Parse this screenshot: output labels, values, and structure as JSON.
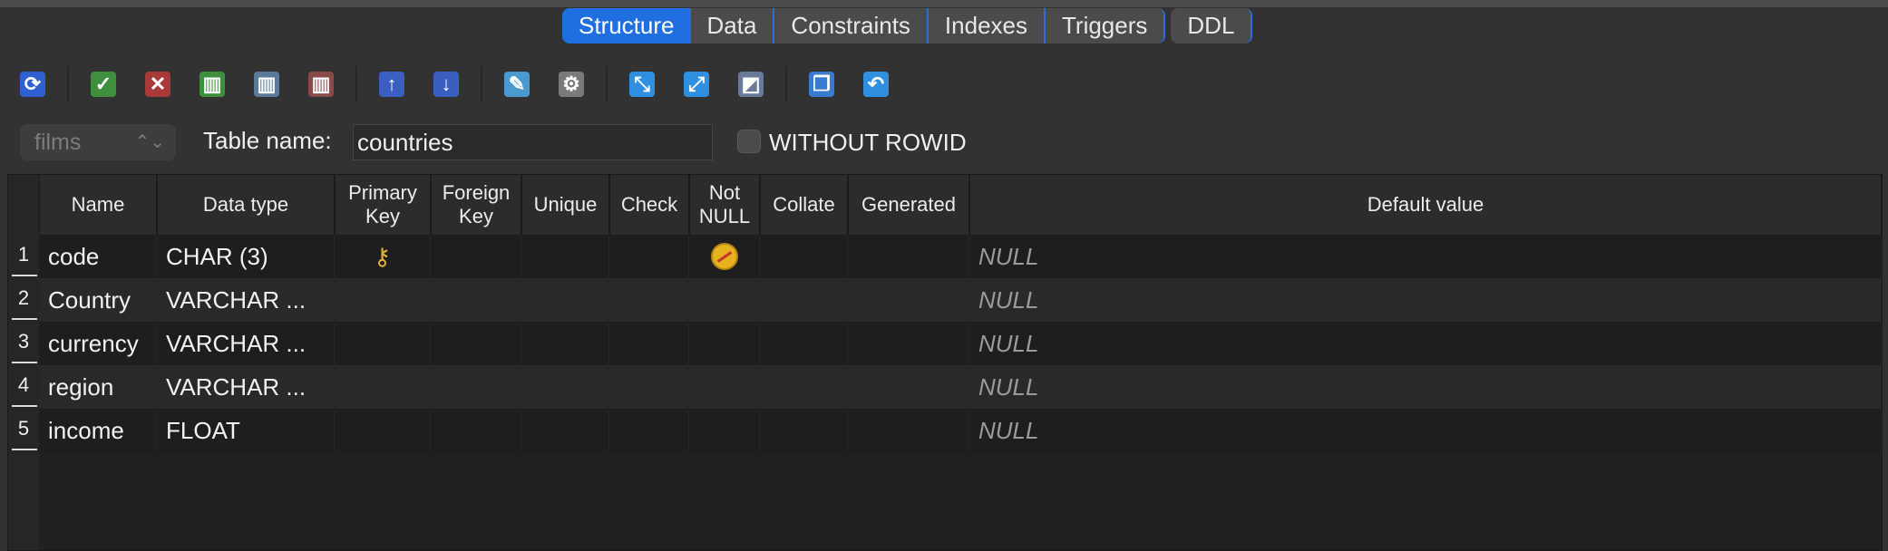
{
  "tabs": [
    "Structure",
    "Data",
    "Constraints",
    "Indexes",
    "Triggers",
    "DDL"
  ],
  "toolbar": {
    "icons": [
      {
        "name": "refresh-icon",
        "color": "#2f5fd0",
        "glyph": "⟳"
      },
      {
        "name": "commit-check-icon",
        "color": "#3f8f3f",
        "glyph": "✓"
      },
      {
        "name": "cancel-x-icon",
        "color": "#a83a3a",
        "glyph": "✕"
      },
      {
        "name": "add-column-icon",
        "color": "#3f8f3f",
        "glyph": "▥"
      },
      {
        "name": "edit-column-icon",
        "color": "#5a7a9a",
        "glyph": "▥"
      },
      {
        "name": "delete-column-icon",
        "color": "#8a4a4a",
        "glyph": "▥"
      },
      {
        "name": "move-up-icon",
        "color": "#3a5fc0",
        "glyph": "↑"
      },
      {
        "name": "move-down-icon",
        "color": "#3a5fc0",
        "glyph": "↓"
      },
      {
        "name": "add-constraint-icon",
        "color": "#4a9ad0",
        "glyph": "✎"
      },
      {
        "name": "settings-gear-icon",
        "color": "#7a7a7a",
        "glyph": "⚙"
      },
      {
        "name": "collapse-icon",
        "color": "#2f8fe0",
        "glyph": "⤡"
      },
      {
        "name": "expand-icon",
        "color": "#2f8fe0",
        "glyph": "⤢"
      },
      {
        "name": "image-export-icon",
        "color": "#6a7a9a",
        "glyph": "◩"
      },
      {
        "name": "windows-icon",
        "color": "#3a7ad0",
        "glyph": "❐"
      },
      {
        "name": "undo-icon",
        "color": "#2f8fe0",
        "glyph": "↶"
      }
    ]
  },
  "database_select": {
    "value": "films"
  },
  "table_name": {
    "label": "Table name:",
    "value": "countries"
  },
  "without_rowid": {
    "label": "WITHOUT ROWID",
    "checked": false
  },
  "columns_headers": [
    "Name",
    "Data type",
    "Primary Key",
    "Foreign Key",
    "Unique",
    "Check",
    "Not NULL",
    "Collate",
    "Generated",
    "Default value"
  ],
  "rows": [
    {
      "num": "1",
      "name": "code",
      "type": "CHAR (3)",
      "pk": true,
      "notnull": true,
      "default": "NULL"
    },
    {
      "num": "2",
      "name": "Country",
      "type": "VARCHAR ...",
      "pk": false,
      "notnull": false,
      "default": "NULL"
    },
    {
      "num": "3",
      "name": "currency",
      "type": "VARCHAR ...",
      "pk": false,
      "notnull": false,
      "default": "NULL"
    },
    {
      "num": "4",
      "name": "region",
      "type": "VARCHAR ...",
      "pk": false,
      "notnull": false,
      "default": "NULL"
    },
    {
      "num": "5",
      "name": "income",
      "type": "FLOAT",
      "pk": false,
      "notnull": false,
      "default": "NULL"
    }
  ]
}
